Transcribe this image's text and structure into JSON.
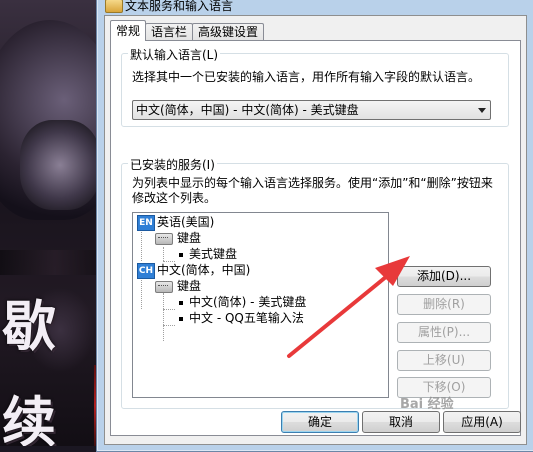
{
  "window": {
    "title": "文本服务和输入语言"
  },
  "tabs": [
    {
      "label": "常规",
      "active": true
    },
    {
      "label": "语言栏",
      "active": false
    },
    {
      "label": "高级键设置",
      "active": false
    }
  ],
  "default_language": {
    "group_title": "默认输入语言(L)",
    "description": "选择其中一个已安装的输入语言，用作所有输入字段的默认语言。",
    "selected": "中文(简体，中国) - 中文(简体) - 美式键盘"
  },
  "installed_services": {
    "group_title": "已安装的服务(I)",
    "description": "为列表中显示的每个输入语言选择服务。使用“添加”和“删除”按钮来修改这个列表。",
    "tree": {
      "en_badge": "EN",
      "en_language": "英语(美国)",
      "en_keyboard_group": "键盘",
      "en_keyboard": "美式键盘",
      "ch_badge": "CH",
      "ch_language": "中文(简体，中国)",
      "ch_keyboard_group": "键盘",
      "ch_item_1": "中文(简体) - 美式键盘",
      "ch_item_2": "中文 - QQ五笔输入法"
    },
    "buttons": {
      "add": "添加(D)...",
      "remove": "删除(R)",
      "properties": "属性(P)...",
      "move_up": "上移(U)",
      "move_down": "下移(O)"
    }
  },
  "footer": {
    "ok": "确定",
    "cancel": "取消",
    "apply": "应用(A)"
  },
  "wallpaper": {
    "glyph_1": "歇 ",
    "glyph_2": "续 "
  },
  "watermark": "Bai 经验",
  "colors": {
    "arrow": "#e8393a",
    "lang_badge": "#2f7fd6"
  }
}
